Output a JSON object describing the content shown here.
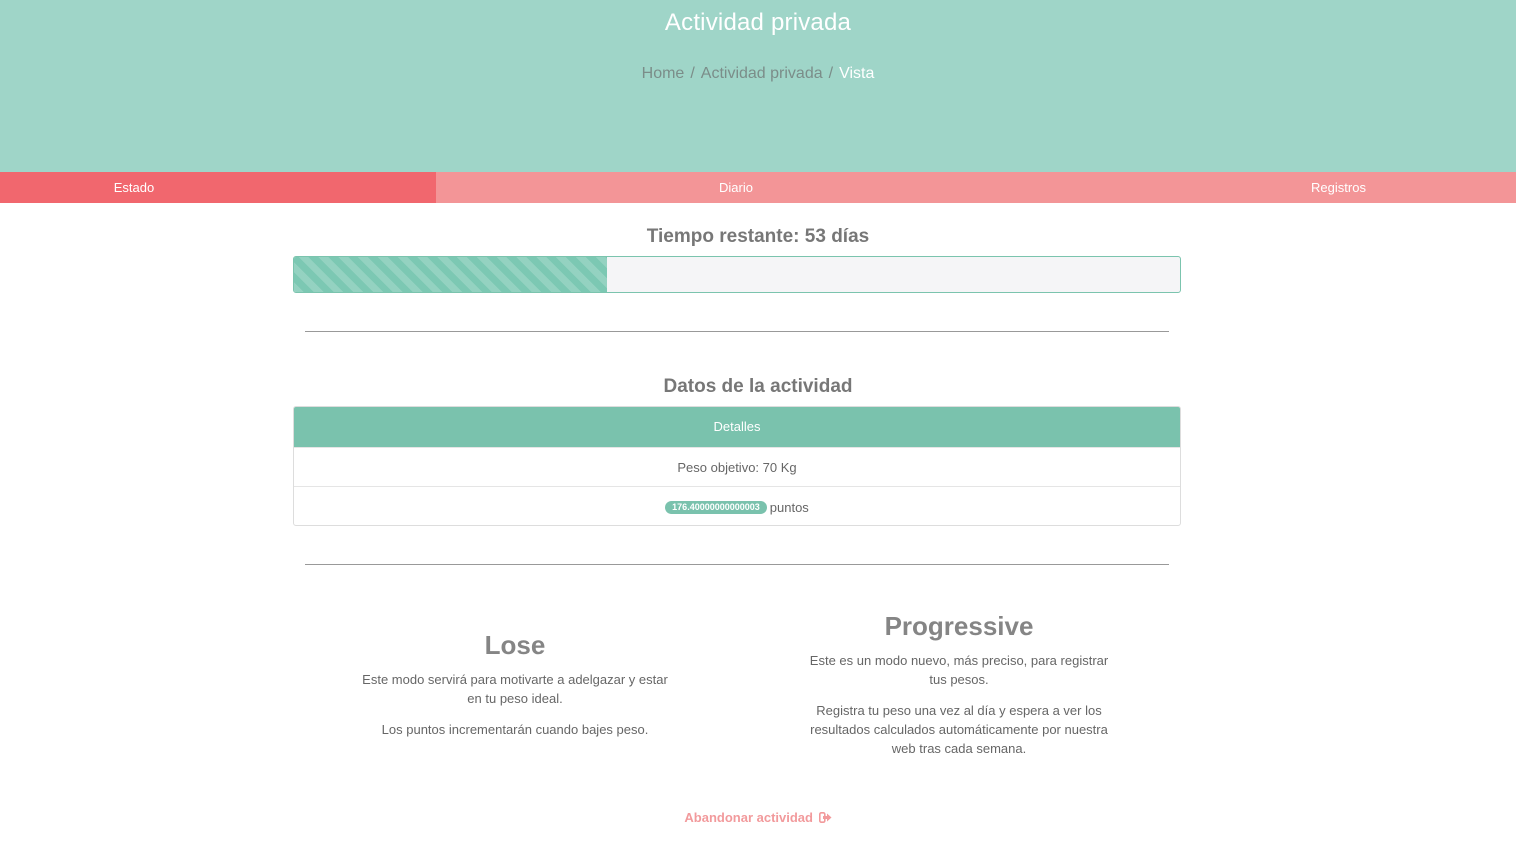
{
  "hero": {
    "title": "Actividad privada",
    "breadcrumb": {
      "home": "Home",
      "section": "Actividad privada",
      "current": "Vista",
      "separator": "/"
    }
  },
  "tabs": {
    "estado": "Estado",
    "diario": "Diario",
    "registros": "Registros",
    "active": "Estado"
  },
  "status": {
    "title": "Tiempo restante: 53 días",
    "progress_fraction": 0.353
  },
  "details": {
    "section_title": "Datos de la actividad",
    "header": "Detalles",
    "target_weight": "Peso objetivo: 70 Kg",
    "points_value": "176.40000000000003",
    "points_label": "puntos"
  },
  "modes": {
    "lose": {
      "title": "Lose",
      "paragraph1": "Este modo servirá para motivarte a adelgazar y estar en tu peso ideal.",
      "paragraph2": "Los puntos incrementarán cuando bajes peso."
    },
    "progressive": {
      "title": "Progressive",
      "paragraph1": "Este es un modo nuevo, más preciso, para registrar tus pesos.",
      "paragraph2": "Registra tu peso una vez al día y espera a ver los resultados calculados automáticamente por nuestra web tras cada semana."
    }
  },
  "abandon": {
    "label": "Abandonar actividad",
    "icon": "sign-out-icon"
  },
  "colors": {
    "hero": "#9fd5c8",
    "tab_active": "#f1676e",
    "tab_bar": "#f39597",
    "accent_green": "#7ac2ad",
    "abandon_text": "#f29a9c"
  }
}
